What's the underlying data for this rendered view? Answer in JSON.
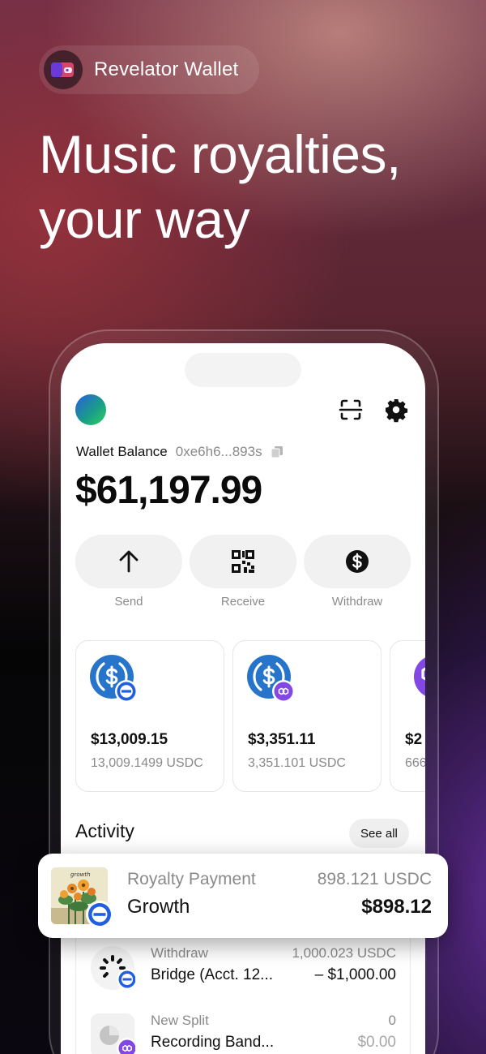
{
  "brand": {
    "name": "Revelator Wallet",
    "logo_icon": "wallet-icon"
  },
  "headline": {
    "line1": "Music royalties,",
    "line2": "your way"
  },
  "wallet": {
    "balance_label": "Wallet Balance",
    "address": "0xe6h6...893s",
    "balance": "$61,197.99"
  },
  "actions": [
    {
      "label": "Send",
      "icon": "arrow-up-icon"
    },
    {
      "label": "Receive",
      "icon": "qr-code-icon"
    },
    {
      "label": "Withdraw",
      "icon": "dollar-circle-icon"
    }
  ],
  "tokens": [
    {
      "value": "$13,009.15",
      "amount": "13,009.1499 USDC",
      "icon": "usdc-icon",
      "badge": "network-badge-blue"
    },
    {
      "value": "$3,351.11",
      "amount": "3,351.101 USDC",
      "icon": "usdc-icon",
      "badge": "polygon-badge"
    },
    {
      "value": "$2",
      "amount": "666",
      "icon": "polygon-icon",
      "badge": ""
    }
  ],
  "activity": {
    "title": "Activity",
    "see_all": "See all",
    "featured": {
      "type": "Royalty Payment",
      "name": "Growth",
      "sub": "898.121 USDC",
      "amount": "$898.12",
      "art_label": "growth"
    },
    "items": [
      {
        "type": "Withdraw",
        "name": "Bridge (Acct. 12...",
        "sub": "1,000.023 USDC",
        "amount": "– $1,000.00"
      },
      {
        "type": "New Split",
        "name": "Recording Band...",
        "sub": "0",
        "amount": "$0.00"
      }
    ]
  },
  "colors": {
    "usdc_blue": "#2775ca",
    "polygon_purple": "#8247e5",
    "badge_blue": "#1f5fe0"
  }
}
